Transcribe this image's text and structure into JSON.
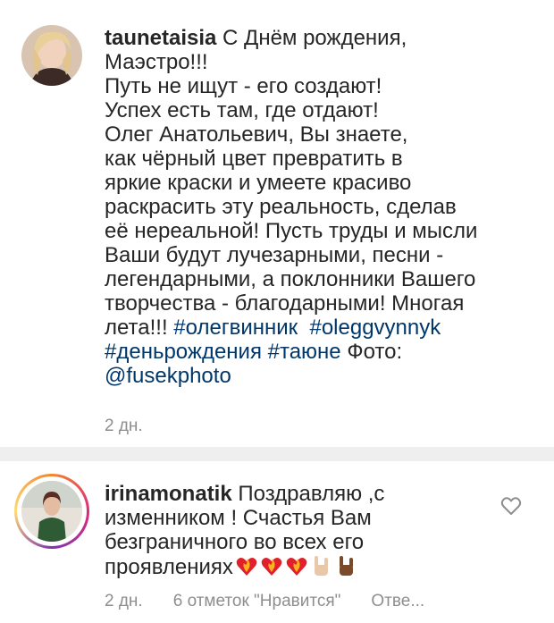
{
  "comment1": {
    "username": "taunetaisia",
    "text_lines": [
      " С Днём рождения,",
      "Маэстро!!!",
      "Путь не ищут - его создают!",
      "Успех есть там, где отдают!",
      "Олег Анатольевич, Вы знаете,",
      "как чёрный цвет превратить в",
      "яркие краски и умеете красиво",
      "раскрасить эту реальность, сделав",
      "её нереальной! Пусть труды и мысли",
      "Ваши будут лучезарными, песни -",
      "легендарными, а поклонники Вашего",
      "творчества - благодарными! Многая"
    ],
    "line13_text": "лета!!! ",
    "hashtag1": "#олегвинник",
    "hashtag2": "#oleggvynnyk",
    "hashtag3": "#деньрождения",
    "hashtag4": "#таюне",
    "photo_label": " Фото:",
    "mention": "@fusekphoto",
    "time": "2 дн."
  },
  "comment2": {
    "username": "irinamonatik",
    "line1": " Поздравляю ,с",
    "line2": "изменником ! Счастья Вам",
    "line3": "безграничного во всех его",
    "line4": "проявлениях",
    "time": "2 дн.",
    "likes": "6 отметок \"Нравится\"",
    "reply": "Отве..."
  },
  "icons": {
    "like": "heart-outline-icon",
    "emoji_heart": "heart-on-fire-emoji",
    "emoji_hand": "horns-hand-emoji"
  },
  "colors": {
    "text": "#262626",
    "meta": "#8e8e8e",
    "link": "#00376b",
    "divider": "#efefef"
  }
}
